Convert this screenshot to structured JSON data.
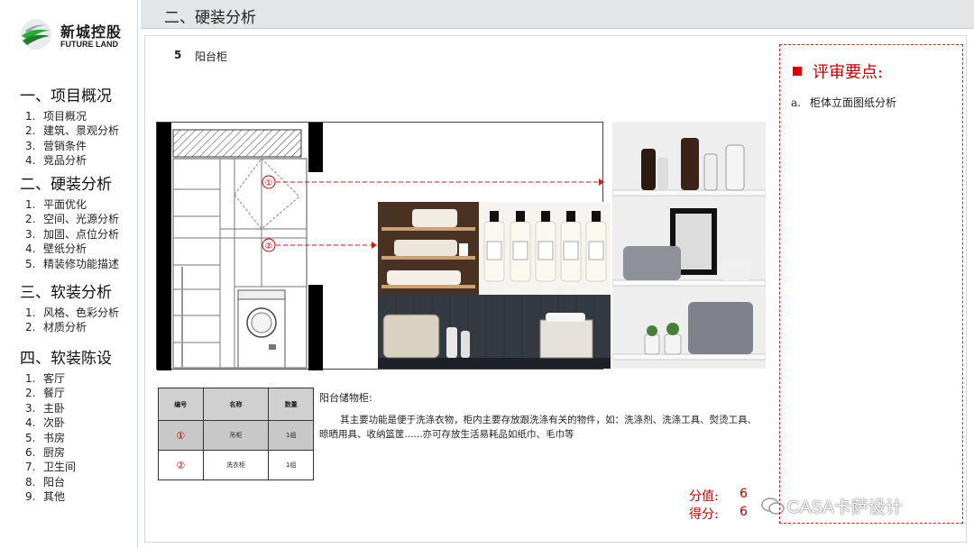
{
  "logo": {
    "name_cn": "新城控股",
    "name_en": "FUTURE LAND"
  },
  "header": {
    "title": "二、硬装分析"
  },
  "nav": [
    {
      "title": "一、项目概况",
      "items": [
        {
          "num": "1.",
          "label": "项目概况"
        },
        {
          "num": "2.",
          "label": "建筑、景观分析"
        },
        {
          "num": "3.",
          "label": "营销条件"
        },
        {
          "num": "4.",
          "label": "竞品分析"
        }
      ]
    },
    {
      "title": "二、硬装分析",
      "items": [
        {
          "num": "1.",
          "label": "平面优化"
        },
        {
          "num": "2.",
          "label": "空间、光源分析"
        },
        {
          "num": "3.",
          "label": "加固、点位分析"
        },
        {
          "num": "4.",
          "label": "壁纸分析"
        },
        {
          "num": "5.",
          "label": "精装修功能描述"
        }
      ]
    },
    {
      "title": "三、软装分析",
      "items": [
        {
          "num": "1.",
          "label": "风格、色彩分析"
        },
        {
          "num": "2.",
          "label": "材质分析"
        }
      ]
    },
    {
      "title": "四、软装陈设",
      "items": [
        {
          "num": "1.",
          "label": "客厅"
        },
        {
          "num": "2.",
          "label": "餐厅"
        },
        {
          "num": "3.",
          "label": "主卧"
        },
        {
          "num": "4.",
          "label": "次卧"
        },
        {
          "num": "5.",
          "label": "书房"
        },
        {
          "num": "6.",
          "label": "厨房"
        },
        {
          "num": "7.",
          "label": "卫生间"
        },
        {
          "num": "8.",
          "label": "阳台"
        },
        {
          "num": "9.",
          "label": "其他"
        }
      ]
    }
  ],
  "section": {
    "number": "5",
    "label": "阳台柜"
  },
  "drawing": {
    "marker1": "①",
    "marker2": "②"
  },
  "table": {
    "headers": [
      "编号",
      "名称",
      "数量"
    ],
    "rows": [
      {
        "id": "①",
        "name": "吊柜",
        "qty": "1组"
      },
      {
        "id": "②",
        "name": "洗衣柜",
        "qty": "1组"
      }
    ]
  },
  "description": {
    "title": "阳台储物柜:",
    "body": "其主要功能是便于洗涤衣物，柜内主要存放跟洗涤有关的物件，如：洗涤剂、洗涤工具、熨烫工具、晾晒用具、收纳篮筐......亦可存放生活易耗品如纸巾、毛巾等"
  },
  "score": {
    "value_label": "分值:",
    "value": "6",
    "score_label": "得分:",
    "score": "6"
  },
  "watermark": {
    "text": "CASA卡萨设计"
  },
  "review": {
    "title": "评审要点:",
    "points": [
      {
        "marker": "a.",
        "text": "柜体立面图纸分析"
      }
    ]
  },
  "colors": {
    "accent_red": "#c00000",
    "header_bg": "#e4e5e7",
    "logo_green": "#2ea836"
  }
}
